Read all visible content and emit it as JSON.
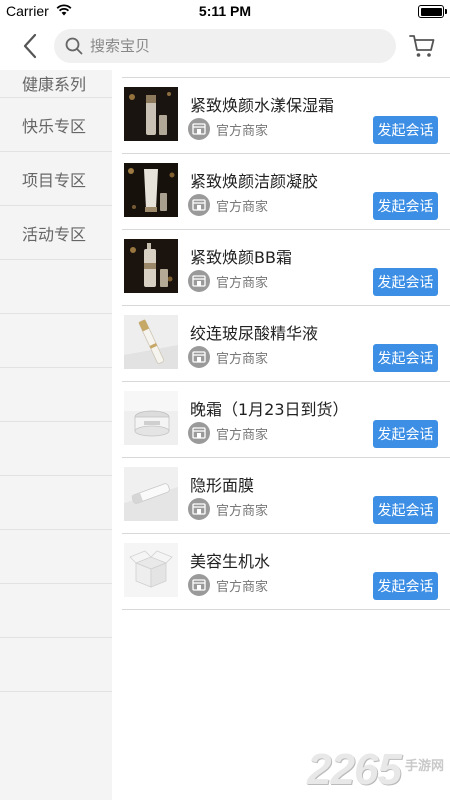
{
  "status_bar": {
    "carrier": "Carrier",
    "time": "5:11 PM"
  },
  "nav": {
    "search_placeholder": "搜索宝贝",
    "back_icon": "chevron-left-icon",
    "cart_icon": "cart-icon"
  },
  "sidebar": {
    "items": [
      {
        "label": "健康系列"
      },
      {
        "label": "快乐专区"
      },
      {
        "label": "项目专区"
      },
      {
        "label": "活动专区"
      }
    ]
  },
  "products": [
    {
      "name": "紧致焕颜水漾保湿霜",
      "merchant": "官方商家",
      "action": "发起会话",
      "thumb": "dark-bottle"
    },
    {
      "name": "紧致焕颜洁颜凝胶",
      "merchant": "官方商家",
      "action": "发起会话",
      "thumb": "dark-tube"
    },
    {
      "name": "紧致焕颜BB霜",
      "merchant": "官方商家",
      "action": "发起会话",
      "thumb": "dark-pump"
    },
    {
      "name": "绞连玻尿酸精华液",
      "merchant": "官方商家",
      "action": "发起会话",
      "thumb": "light-vial"
    },
    {
      "name": "晚霜（1月23日到货）",
      "merchant": "官方商家",
      "action": "发起会话",
      "thumb": "light-jar"
    },
    {
      "name": "隐形面膜",
      "merchant": "官方商家",
      "action": "发起会话",
      "thumb": "light-tube"
    },
    {
      "name": "美容生机水",
      "merchant": "官方商家",
      "action": "发起会话",
      "thumb": "empty-box"
    }
  ],
  "watermark": {
    "digits": "2265",
    "sub": "手游网"
  },
  "colors": {
    "accent": "#3d8fe5",
    "sidebar_bg": "#f4f4f4",
    "search_bg": "#f0f0f0"
  }
}
